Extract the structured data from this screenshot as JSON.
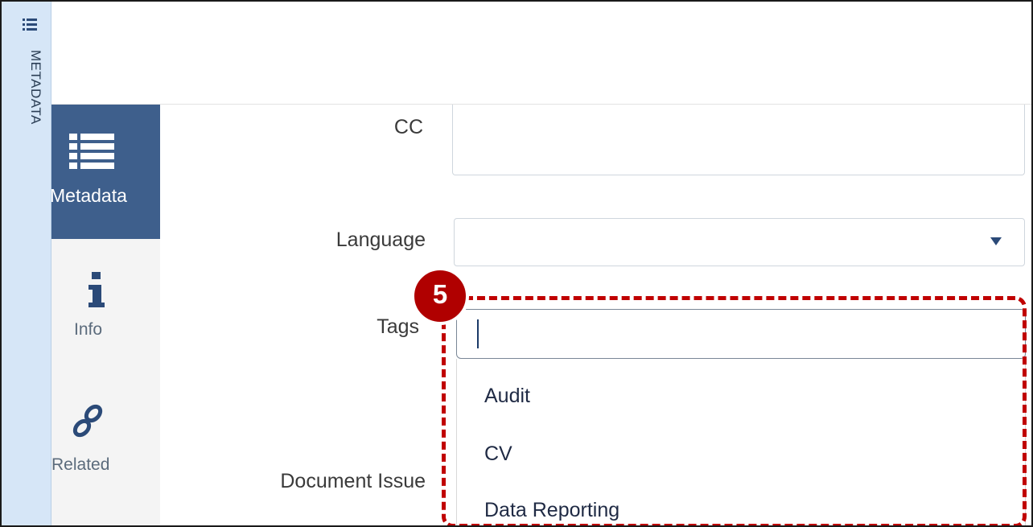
{
  "meta_strip": {
    "label": "METADATA",
    "icon": "list-icon"
  },
  "nav": {
    "metadata": {
      "label": "Metadata",
      "icon": "list-icon"
    },
    "info": {
      "label": "Info",
      "icon": "info-icon"
    },
    "related": {
      "label": "Related",
      "icon": "link-icon"
    }
  },
  "form": {
    "cc_label": "CC",
    "cc_value": "",
    "language_label": "Language",
    "language_value": "",
    "tags_label": "Tags",
    "tags_value": "",
    "issue_label": "Document Issue"
  },
  "tags_options": [
    "Audit",
    "CV",
    "Data Reporting"
  ],
  "callout": {
    "number": "5",
    "color": "#c00000"
  },
  "colors": {
    "accent": "#3e5f8c",
    "strip": "#d6e6f7"
  }
}
